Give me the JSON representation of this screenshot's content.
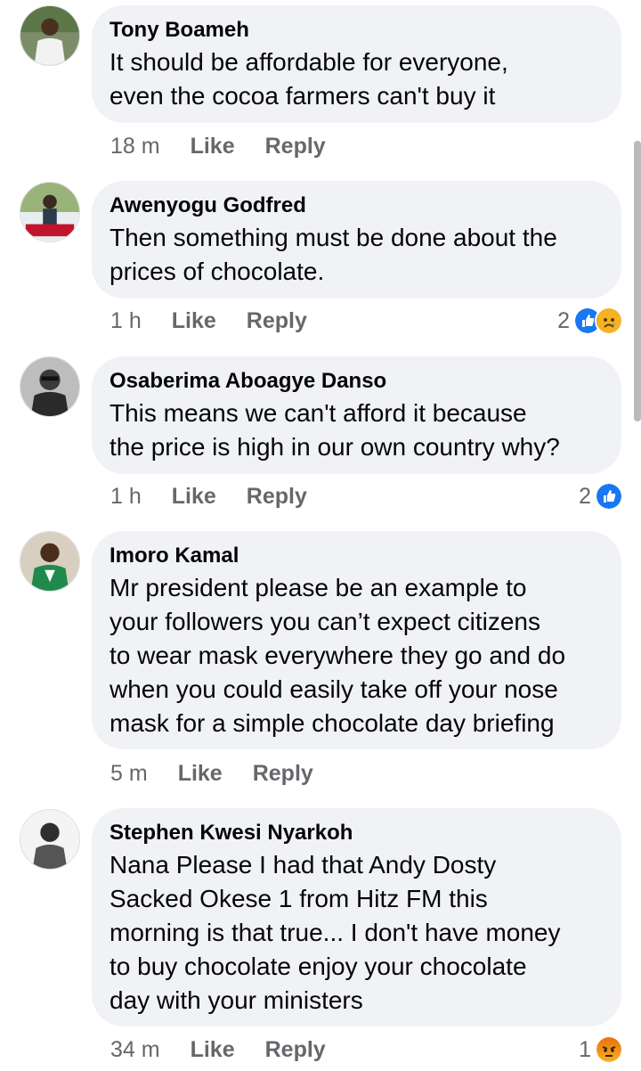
{
  "comments": [
    {
      "author": "Tony Boameh",
      "lines": [
        "It should be affordable for everyone,",
        "even the cocoa farmers can't buy it"
      ],
      "time": "18 m",
      "like": "Like",
      "reply": "Reply",
      "reaction_count": ""
    },
    {
      "author": "Awenyogu Godfred",
      "lines": [
        "Then something must be done about the",
        "prices of chocolate."
      ],
      "time": "1 h",
      "like": "Like",
      "reply": "Reply",
      "reaction_count": "2",
      "reactions": [
        "like-icon",
        "sad-icon"
      ]
    },
    {
      "author": "Osaberima Aboagye Danso",
      "lines": [
        "This means we can't afford it because",
        "the price is high in our own country why?"
      ],
      "time": "1 h",
      "like": "Like",
      "reply": "Reply",
      "reaction_count": "2",
      "reactions": [
        "like-icon"
      ]
    },
    {
      "author": "Imoro Kamal",
      "lines": [
        "Mr president please be an example to",
        "your followers you can’t expect citizens",
        "to wear mask everywhere they go and do",
        "when you could easily take off your nose",
        "mask for a simple chocolate day briefing"
      ],
      "time": "5 m",
      "like": "Like",
      "reply": "Reply",
      "reaction_count": ""
    },
    {
      "author": "Stephen Kwesi Nyarkoh",
      "lines": [
        "Nana Please I had that Andy Dosty",
        "Sacked Okese 1 from Hitz FM this",
        "morning is that true... I don't have money",
        "to buy chocolate enjoy your chocolate",
        "day with your ministers"
      ],
      "time": "34 m",
      "like": "Like",
      "reply": "Reply",
      "reaction_count": "1",
      "reactions": [
        "angry-icon"
      ]
    }
  ],
  "colors": {
    "bubble": "#f0f2f5",
    "meta": "#65676b",
    "like_blue": "#1877f2"
  }
}
